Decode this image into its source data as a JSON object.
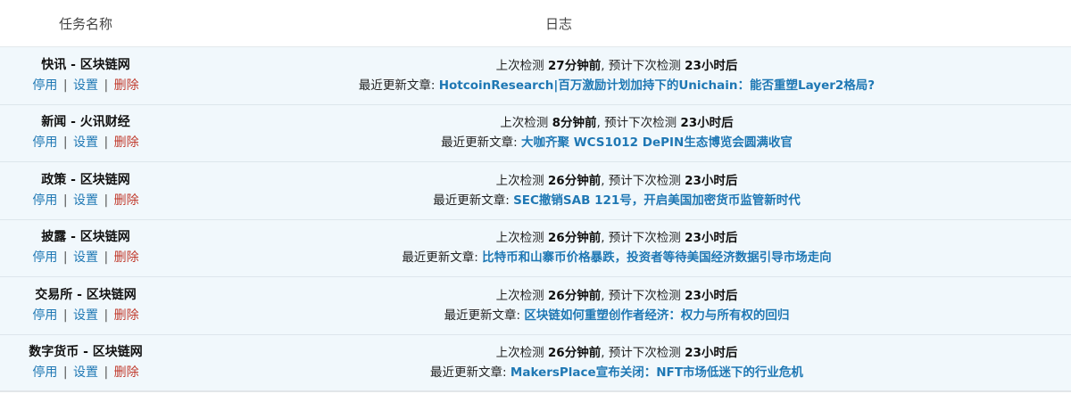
{
  "header": {
    "task_name": "任务名称",
    "log": "日志"
  },
  "actions": {
    "disable": "停用",
    "separator": "|",
    "settings": "设置",
    "delete": "删除"
  },
  "labels": {
    "last_check": "上次检测",
    "next_check": ", 预计下次检测",
    "recent_article": "最近更新文章:"
  },
  "colors": {
    "row_background": "#f1f8fc",
    "link_blue": "#1f78b4",
    "delete_red": "#c0392b"
  },
  "tasks": [
    {
      "title": "快讯 - 区块链网",
      "last_check": "27分钟前",
      "next_check": "23小时后",
      "article": "HotcoinResearch|百万激励计划加持下的Unichain：能否重塑Layer2格局?"
    },
    {
      "title": "新闻 - 火讯财经",
      "last_check": "8分钟前",
      "next_check": "23小时后",
      "article": "大咖齐聚 WCS1012 DePIN生态博览会圆满收官"
    },
    {
      "title": "政策 - 区块链网",
      "last_check": "26分钟前",
      "next_check": "23小时后",
      "article": "SEC撤销SAB 121号，开启美国加密货币监管新时代"
    },
    {
      "title": "披露 - 区块链网",
      "last_check": "26分钟前",
      "next_check": "23小时后",
      "article": "比特币和山寨币价格暴跌，投资者等待美国经济数据引导市场走向"
    },
    {
      "title": "交易所 - 区块链网",
      "last_check": "26分钟前",
      "next_check": "23小时后",
      "article": "区块链如何重塑创作者经济：权力与所有权的回归"
    },
    {
      "title": "数字货币 - 区块链网",
      "last_check": "26分钟前",
      "next_check": "23小时后",
      "article": "MakersPlace宣布关闭：NFT市场低迷下的行业危机"
    }
  ]
}
